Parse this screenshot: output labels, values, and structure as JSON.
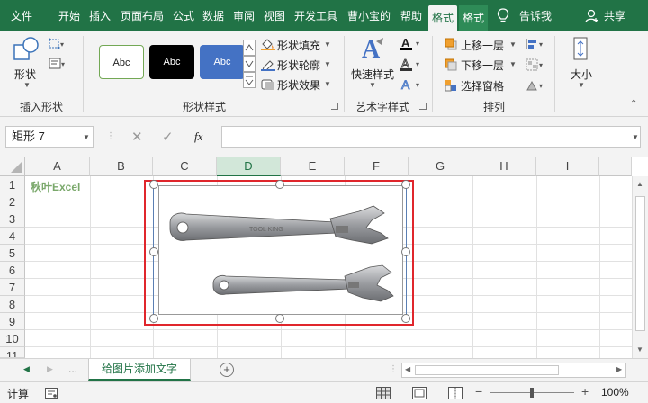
{
  "tabs": [
    "文件",
    "开始",
    "插入",
    "页面布局",
    "公式",
    "数据",
    "审阅",
    "视图",
    "开发工具",
    "曹小宝的",
    "帮助",
    "格式",
    "格式"
  ],
  "tell_me": "告诉我",
  "share": "共享",
  "ribbon": {
    "shape_btn": "形状",
    "insert_group": "插入形状",
    "style_samples": [
      "Abc",
      "Abc",
      "Abc"
    ],
    "shape_fill": "形状填充",
    "shape_outline": "形状轮廓",
    "shape_effect": "形状效果",
    "shape_style_group": "形状样式",
    "quick_style": "快速样式",
    "art_group": "艺术字样式",
    "bring_forward": "上移一层",
    "send_backward": "下移一层",
    "selection_pane": "选择窗格",
    "arrange_group": "排列",
    "size_btn": "大小",
    "accent": "#217346"
  },
  "formula": {
    "name_box": "矩形 7",
    "fx": "fx"
  },
  "grid": {
    "columns": [
      "A",
      "B",
      "C",
      "D",
      "E",
      "F",
      "G",
      "H",
      "I"
    ],
    "rows": [
      "1",
      "2",
      "3",
      "4",
      "5",
      "6",
      "7",
      "8",
      "9",
      "10",
      "11"
    ],
    "a1_text": "秋叶Excel"
  },
  "sheet": {
    "dots": "...",
    "active_sheet": "给图片添加文字"
  },
  "status": {
    "mode": "计算",
    "zoom": "100%"
  }
}
